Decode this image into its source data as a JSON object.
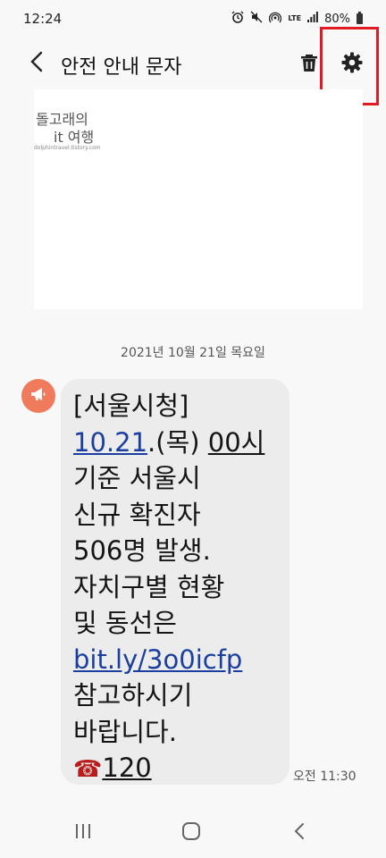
{
  "status_bar": {
    "time": "12:24",
    "lte": "LTE",
    "battery": "80%",
    "icons": [
      "alarm-icon",
      "mute-icon",
      "hotspot-icon",
      "lte-icon",
      "signal-icon",
      "battery-icon"
    ]
  },
  "app_bar": {
    "title": "안전 안내 문자",
    "actions": [
      "back-icon",
      "trash-icon",
      "gear-icon"
    ]
  },
  "watermark": {
    "line1": "돌고래의",
    "line2": "it 여행",
    "url": "dolphintravel.tistory.com"
  },
  "conversation": {
    "date": "2021년 10월 21일 목요일",
    "message": {
      "line1": "[서울시청]",
      "line2_link_date": "10.21",
      "line2_mid": ".(목) ",
      "line2_time": "00시",
      "line3": "기준 서울시",
      "line4": "신규 확진자",
      "line5": "506명 발생.",
      "line6": "자치구별 현황",
      "line7": "및 동선은",
      "link": "bit.ly/3o0icfp",
      "line9": "참고하시기",
      "line10": "바랍니다.",
      "phone_emoji": "☎",
      "phone": "120"
    },
    "time": "오전 11:30"
  },
  "colors": {
    "accent_link": "#1b3fa0",
    "avatar": "#ef7a5c",
    "highlight": "#e21a22",
    "bubble": "#ececec"
  }
}
